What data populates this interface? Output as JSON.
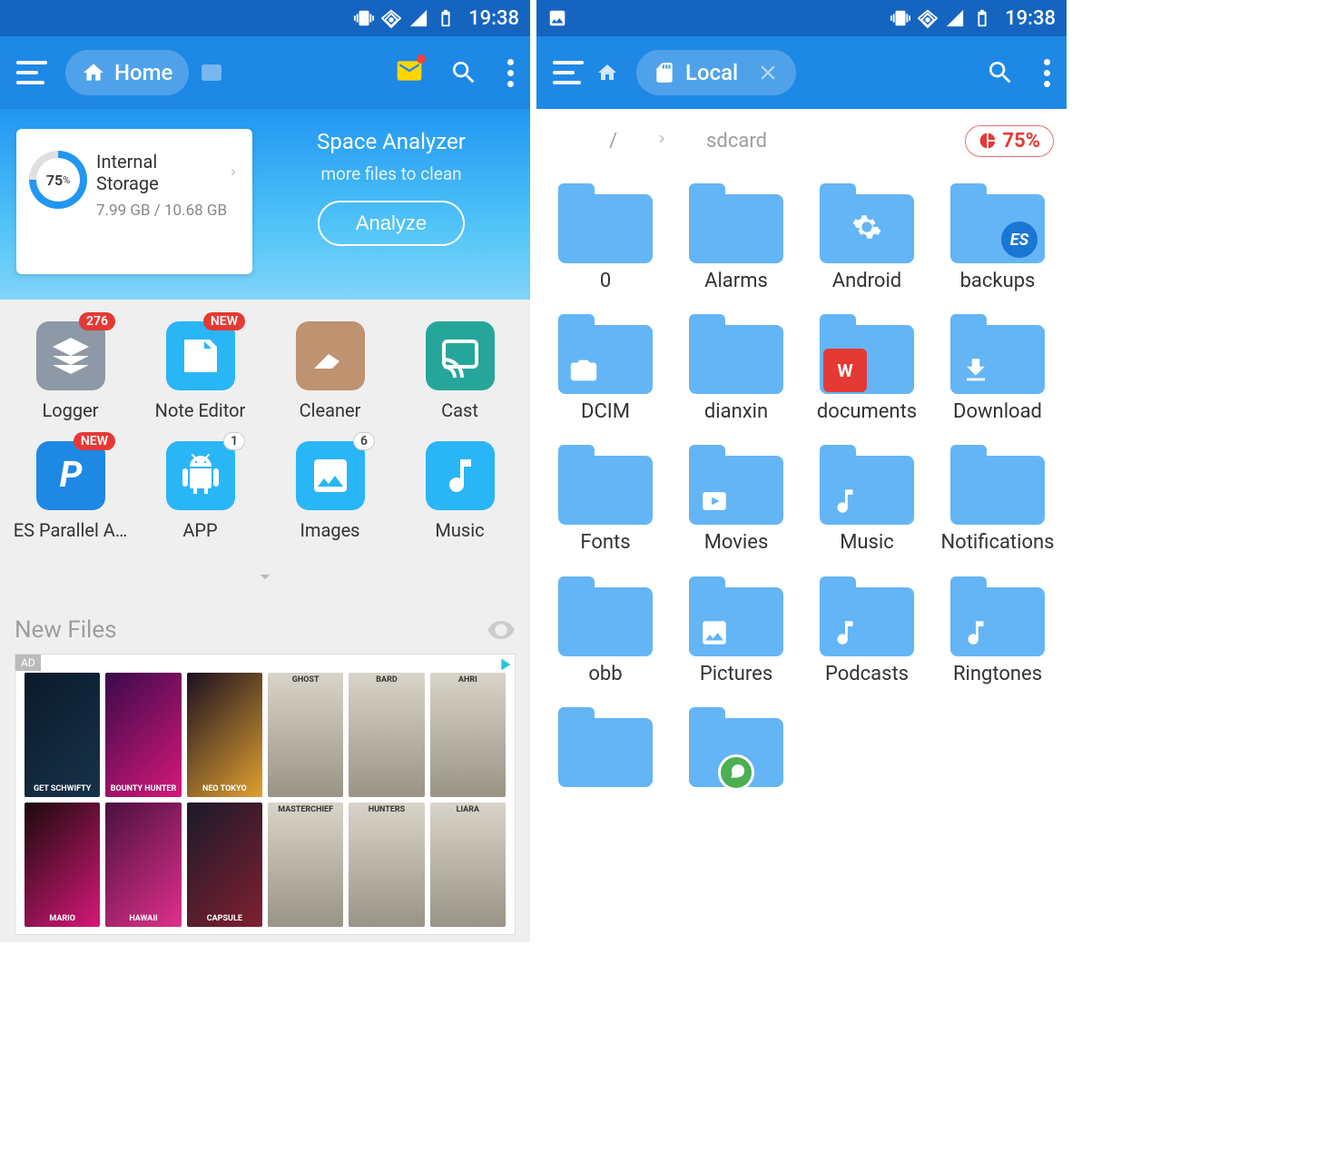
{
  "status": {
    "time": "19:38"
  },
  "left": {
    "toolbar": {
      "home_label": "Home"
    },
    "storage": {
      "percent": "75",
      "percent_suffix": "%",
      "title": "Internal Storage",
      "usage": "7.99 GB / 10.68 GB"
    },
    "analyzer": {
      "title": "Space Analyzer",
      "subtitle": "more files to clean",
      "button": "Analyze"
    },
    "shortcuts": [
      {
        "label": "Logger",
        "badge": "276",
        "badge_type": "red",
        "color": "#8d99a6",
        "icon": "stack"
      },
      {
        "label": "Note Editor",
        "badge": "NEW",
        "badge_type": "red",
        "color": "#29b6f6",
        "icon": "note"
      },
      {
        "label": "Cleaner",
        "badge": "",
        "badge_type": "",
        "color": "#bf9270",
        "icon": "broom"
      },
      {
        "label": "Cast",
        "badge": "",
        "badge_type": "",
        "color": "#26a69a",
        "icon": "cast"
      },
      {
        "label": "ES Parallel A…",
        "badge": "NEW",
        "badge_type": "red",
        "color": "#1e88e5",
        "icon": "p"
      },
      {
        "label": "APP",
        "badge": "1",
        "badge_type": "count",
        "color": "#29b6f6",
        "icon": "android"
      },
      {
        "label": "Images",
        "badge": "6",
        "badge_type": "count",
        "color": "#29b6f6",
        "icon": "image"
      },
      {
        "label": "Music",
        "badge": "",
        "badge_type": "",
        "color": "#29b6f6",
        "icon": "music"
      }
    ],
    "new_files": {
      "title": "New Files"
    },
    "ad": {
      "tag": "AD",
      "tiles": [
        "GET SCHWIFTY",
        "BOUNTY HUNTER",
        "NEO TOKYO",
        "GHOST",
        "BARD",
        "AHRI",
        "MARIO",
        "HAWAII",
        "CAPSULE",
        "MASTERCHIEF",
        "HUNTERS",
        "LIARA"
      ]
    }
  },
  "right": {
    "toolbar": {
      "local_label": "Local"
    },
    "breadcrumb": {
      "root": "/",
      "current": "sdcard"
    },
    "storage_pill": "75%",
    "folders": [
      {
        "label": "0",
        "overlay": ""
      },
      {
        "label": "Alarms",
        "overlay": ""
      },
      {
        "label": "Android",
        "overlay": "gear"
      },
      {
        "label": "backups",
        "overlay": "es"
      },
      {
        "label": "DCIM",
        "overlay": "camera"
      },
      {
        "label": "dianxin",
        "overlay": ""
      },
      {
        "label": "documents",
        "overlay": "wps"
      },
      {
        "label": "Download",
        "overlay": "download"
      },
      {
        "label": "Fonts",
        "overlay": ""
      },
      {
        "label": "Movies",
        "overlay": "play"
      },
      {
        "label": "Music",
        "overlay": "music"
      },
      {
        "label": "Notifica­tions",
        "overlay": ""
      },
      {
        "label": "obb",
        "overlay": ""
      },
      {
        "label": "Pictures",
        "overlay": "image"
      },
      {
        "label": "Podcasts",
        "overlay": "music"
      },
      {
        "label": "Ringtones",
        "overlay": "music"
      },
      {
        "label": "",
        "overlay": ""
      },
      {
        "label": "",
        "overlay": "whatsapp"
      }
    ]
  }
}
